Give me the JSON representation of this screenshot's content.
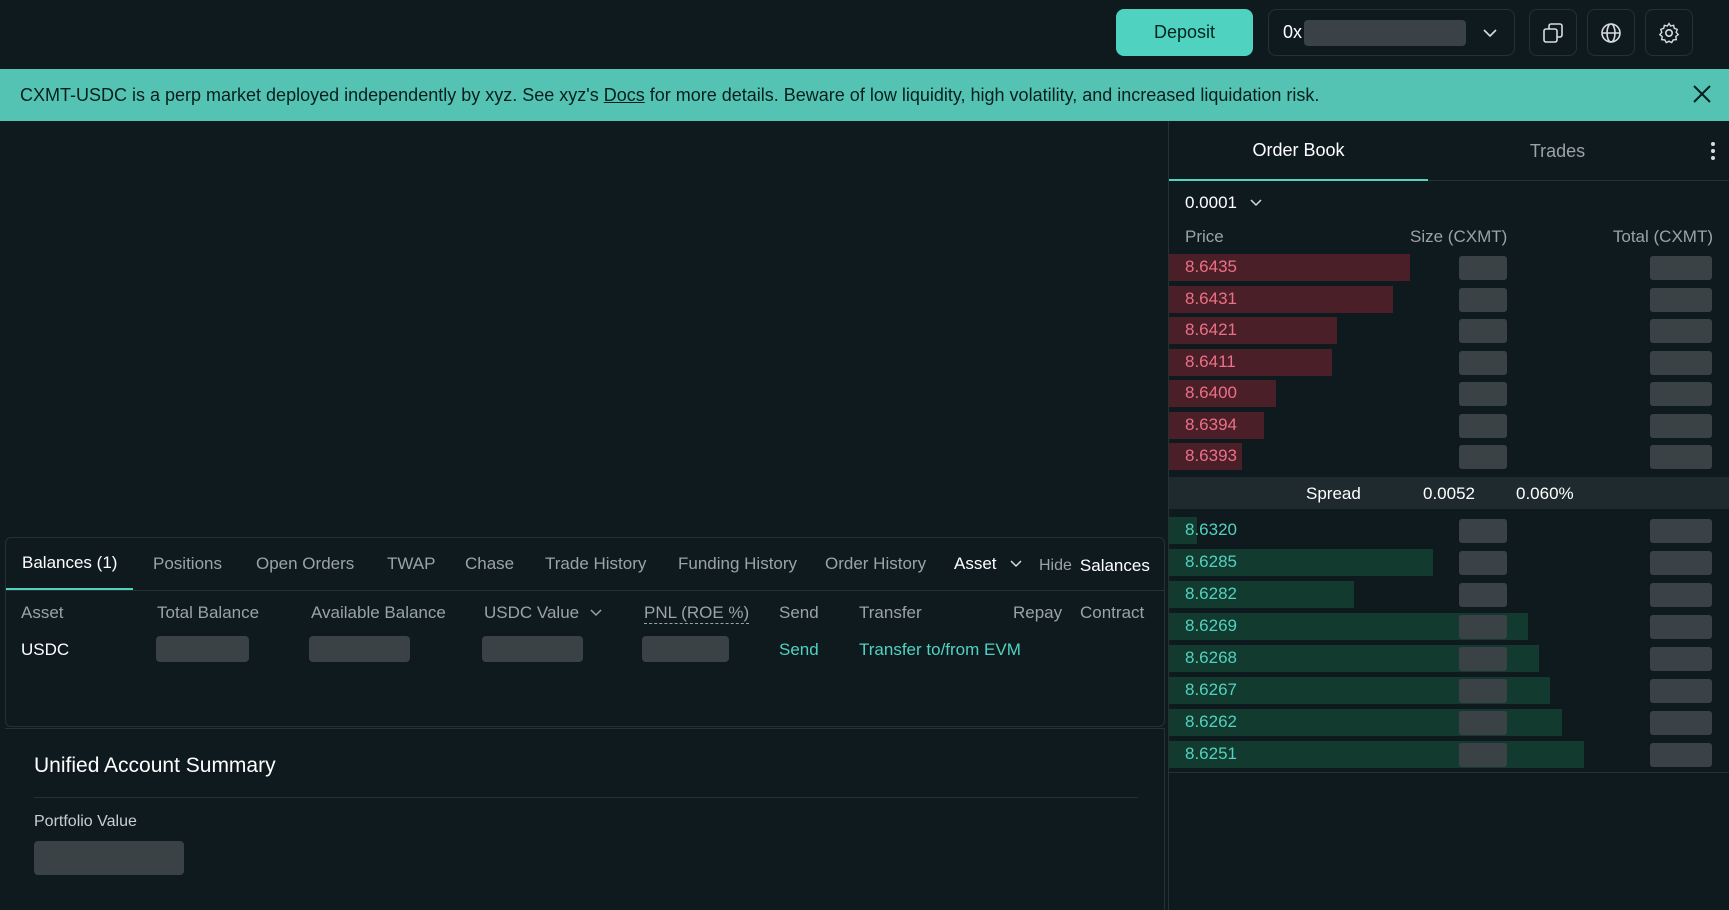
{
  "topbar": {
    "deposit_label": "Deposit",
    "wallet_prefix": "0x"
  },
  "banner": {
    "text_before": "CXMT-USDC is a perp market deployed independently by xyz. See xyz's ",
    "docs_link": "Docs",
    "text_after": " for more details. Beware of low liquidity, high volatility, and increased liquidation risk."
  },
  "orderbook": {
    "tabs": [
      "Order Book",
      "Trades"
    ],
    "tick_size": "0.0001",
    "headers": {
      "price": "Price",
      "size": "Size (CXMT)",
      "total": "Total (CXMT)"
    },
    "asks": [
      {
        "price": "8.6435",
        "depth_pct": 43
      },
      {
        "price": "8.6431",
        "depth_pct": 40
      },
      {
        "price": "8.6421",
        "depth_pct": 30
      },
      {
        "price": "8.6411",
        "depth_pct": 29
      },
      {
        "price": "8.6400",
        "depth_pct": 19
      },
      {
        "price": "8.6394",
        "depth_pct": 17
      },
      {
        "price": "8.6393",
        "depth_pct": 13
      }
    ],
    "spread": {
      "label": "Spread",
      "value": "0.0052",
      "percent": "0.060%"
    },
    "bids": [
      {
        "price": "8.6320",
        "depth_pct": 5
      },
      {
        "price": "8.6285",
        "depth_pct": 47
      },
      {
        "price": "8.6282",
        "depth_pct": 33
      },
      {
        "price": "8.6269",
        "depth_pct": 64
      },
      {
        "price": "8.6268",
        "depth_pct": 66
      },
      {
        "price": "8.6267",
        "depth_pct": 68
      },
      {
        "price": "8.6262",
        "depth_pct": 70
      },
      {
        "price": "8.6251",
        "depth_pct": 74
      }
    ]
  },
  "bottom": {
    "tabs": [
      "Balances (1)",
      "Positions",
      "Open Orders",
      "TWAP",
      "Chase",
      "Trade History",
      "Funding History",
      "Order History"
    ],
    "asset_filter": "Asset",
    "hide_label": "Hide",
    "hide_target": "Salances",
    "columns": [
      "Asset",
      "Total Balance",
      "Available Balance",
      "USDC Value",
      "PNL (ROE %)",
      "Send",
      "Transfer",
      "Repay",
      "Contract"
    ],
    "row": {
      "asset": "USDC",
      "send": "Send",
      "transfer": "Transfer to/from EVM"
    }
  },
  "summary": {
    "title": "Unified Account Summary",
    "portfolio_label": "Portfolio Value"
  },
  "colors": {
    "accent": "#50d2c1",
    "ask": "#ed7088",
    "background": "#0f1a1f"
  }
}
